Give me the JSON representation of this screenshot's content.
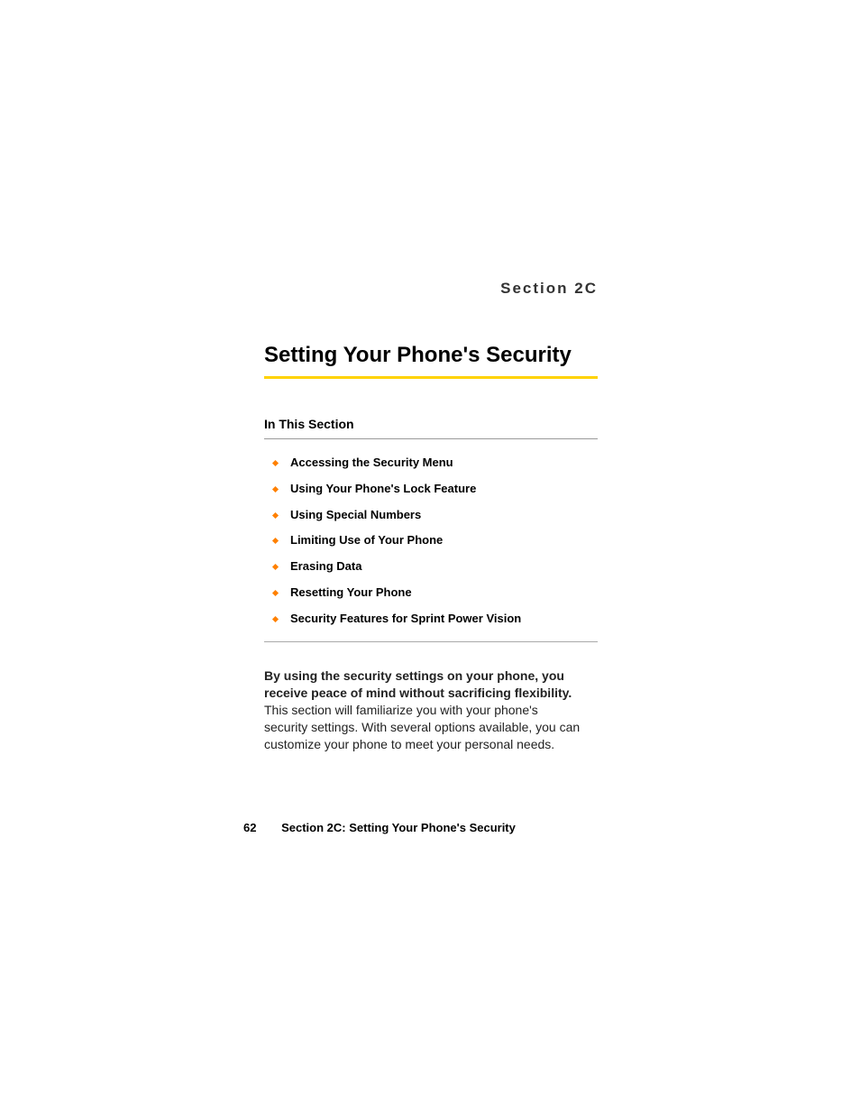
{
  "section_label": "Section 2C",
  "chapter_title": "Setting Your Phone's Security",
  "subsection_heading": "In This Section",
  "toc_items": [
    "Accessing the Security Menu",
    "Using Your Phone's Lock Feature",
    "Using Special Numbers",
    "Limiting Use of Your Phone",
    "Erasing Data",
    "Resetting Your Phone",
    "Security Features for Sprint Power Vision"
  ],
  "paragraph": {
    "bold_lead": "By using the security settings on your phone, you receive peace of mind without sacrificing flexibility.",
    "rest": " This section will familiarize you with your phone's security settings. With several options available, you can customize your phone to meet your personal needs."
  },
  "footer": {
    "page_num": "62",
    "text": "Section 2C: Setting Your Phone's Security"
  }
}
